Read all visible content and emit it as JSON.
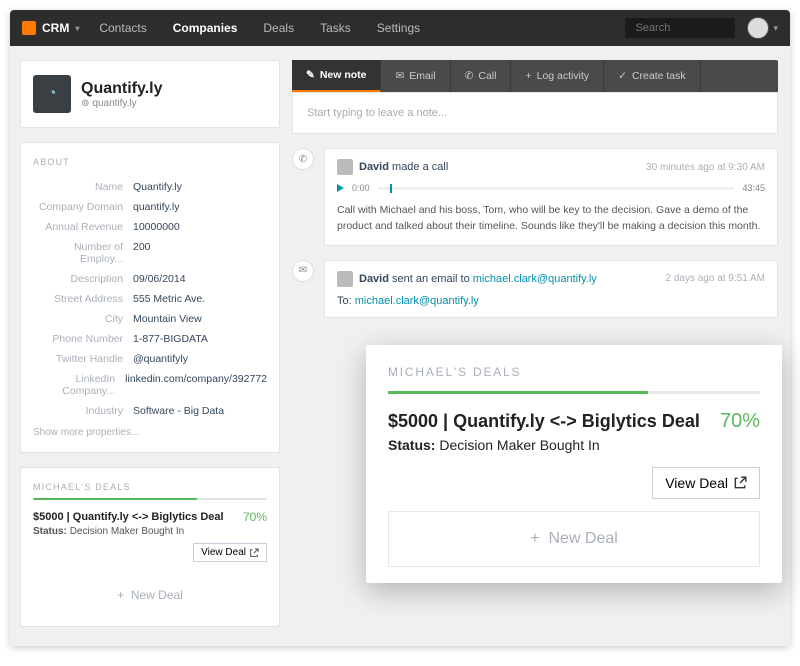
{
  "nav": {
    "brand": "CRM",
    "items": [
      "Contacts",
      "Companies",
      "Deals",
      "Tasks",
      "Settings"
    ],
    "active_index": 1,
    "search_placeholder": "Search"
  },
  "company": {
    "name": "Quantify.ly",
    "url": "quantify.ly"
  },
  "about": {
    "label": "ABOUT",
    "props": [
      {
        "k": "Name",
        "v": "Quantify.ly"
      },
      {
        "k": "Company Domain",
        "v": "quantify.ly"
      },
      {
        "k": "Annual Revenue",
        "v": "10000000"
      },
      {
        "k": "Number of Employ...",
        "v": "200"
      },
      {
        "k": "Description",
        "v": "09/06/2014"
      },
      {
        "k": "Street Address",
        "v": "555 Metric Ave."
      },
      {
        "k": "City",
        "v": "Mountain View"
      },
      {
        "k": "Phone Number",
        "v": "1-877-BIGDATA"
      },
      {
        "k": "Twitter Handle",
        "v": "@quantifyly"
      },
      {
        "k": "LinkedIn Company...",
        "v": "linkedin.com/company/392772"
      },
      {
        "k": "Industry",
        "v": "Software - Big Data"
      }
    ],
    "show_more": "Show more properties..."
  },
  "deals_sidebar": {
    "label": "MICHAEL'S DEALS",
    "title": "$5000 | Quantify.ly <-> Biglytics Deal",
    "pct": "70%",
    "status_label": "Status:",
    "status_value": "Decision Maker Bought In",
    "view": "View Deal",
    "new": "New Deal"
  },
  "tabs": {
    "items": [
      "New note",
      "Email",
      "Call",
      "Log activity",
      "Create task"
    ],
    "active_index": 0
  },
  "note_placeholder": "Start typing to leave a note...",
  "activity_call": {
    "actor": "David",
    "action": "made a call",
    "time": "30 minutes ago at 9:30 AM",
    "current": "0:00",
    "duration": "43:45",
    "text": "Call with Michael and his boss, Tom, who will be key to the decision. Gave a demo of the product and talked about their timeline. Sounds like they'll be making a decision this month."
  },
  "activity_email": {
    "actor": "David",
    "action": "sent an email to",
    "recipient": "michael.clark@quantify.ly",
    "time": "2 days ago at 9:51 AM",
    "to_label": "To:"
  },
  "overlay": {
    "label": "MICHAEL'S DEALS",
    "title": "$5000 | Quantify.ly <-> Biglytics Deal",
    "pct": "70%",
    "status_label": "Status:",
    "status_value": "Decision Maker Bought In",
    "view": "View Deal",
    "new": "New Deal"
  }
}
